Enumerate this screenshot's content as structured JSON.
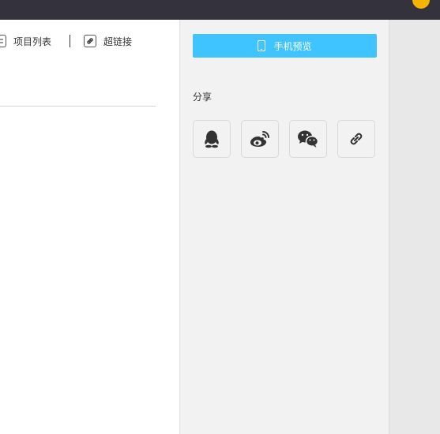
{
  "toolbar": {
    "list_label": "项目列表",
    "link_label": "超链接"
  },
  "sidebar": {
    "preview_label": "手机预览",
    "share_label": "分享",
    "share_buttons": [
      "qq-icon",
      "weibo-icon",
      "wechat-icon",
      "link-icon"
    ]
  },
  "colors": {
    "topbar": "#34333d",
    "accent": "#40c4ff",
    "avatar": "#f4b400",
    "panel": "#f2f2f2"
  }
}
